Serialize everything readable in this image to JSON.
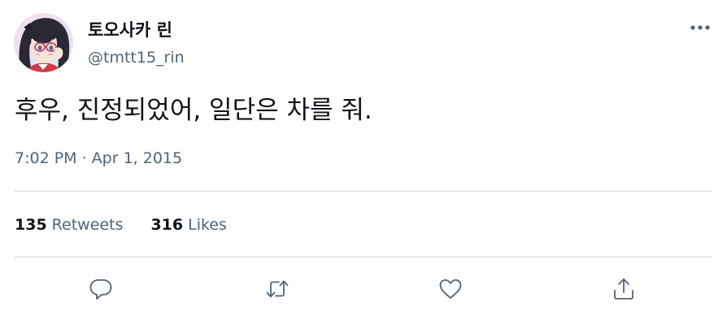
{
  "author": {
    "display_name": "토오사카 린",
    "handle": "@tmtt15_rin",
    "avatar_icon": "anime-avatar-image"
  },
  "tweet": {
    "text": "후우, 진정되었어, 일단은 차를 줘.",
    "timestamp": "7:02 PM · Apr 1, 2015"
  },
  "stats": {
    "retweets_count": "135",
    "retweets_label": "Retweets",
    "likes_count": "316",
    "likes_label": "Likes"
  },
  "actions": [
    {
      "name": "reply",
      "icon": "speech-bubble-icon"
    },
    {
      "name": "retweet",
      "icon": "retweet-arrows-icon"
    },
    {
      "name": "like",
      "icon": "heart-icon"
    },
    {
      "name": "share",
      "icon": "share-upload-icon"
    }
  ],
  "colors": {
    "text_primary": "#0f1419",
    "text_secondary": "#536471",
    "divider": "#cfd9de",
    "background": "#ffffff"
  }
}
